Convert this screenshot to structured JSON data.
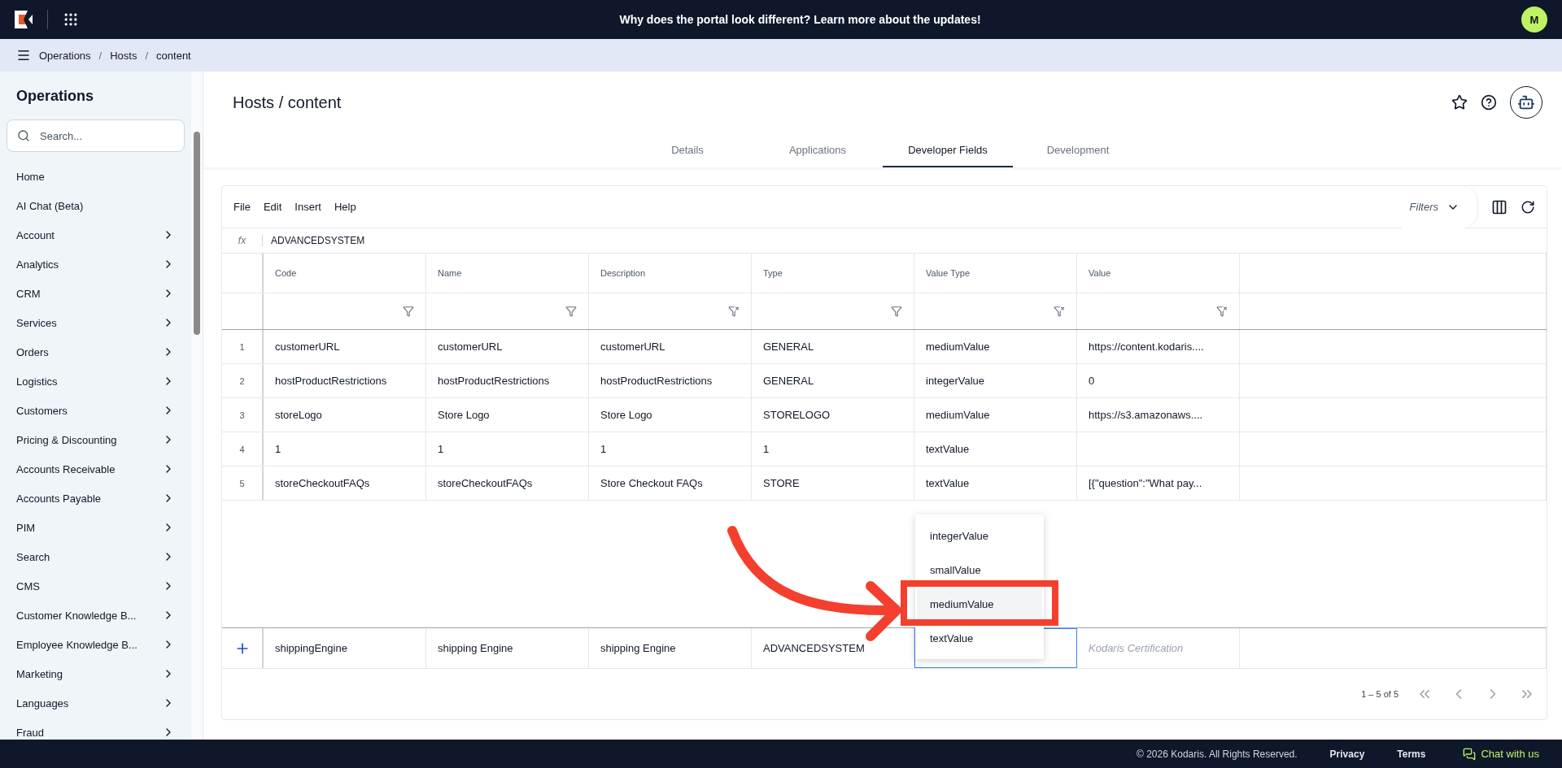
{
  "top_bar": {
    "banner": "Why does the portal look different? ",
    "banner_link": "Learn more about the updates!",
    "avatar": "M"
  },
  "breadcrumb": [
    "Operations",
    "Hosts",
    "content"
  ],
  "breadcrumb_separator": "/",
  "sidebar": {
    "title": "Operations",
    "search": {
      "placeholder": "Search..."
    },
    "items": [
      {
        "label": "Home",
        "has_children": false
      },
      {
        "label": "AI Chat (Beta)",
        "has_children": false
      },
      {
        "label": "Account",
        "has_children": true
      },
      {
        "label": "Analytics",
        "has_children": true
      },
      {
        "label": "CRM",
        "has_children": true
      },
      {
        "label": "Services",
        "has_children": true
      },
      {
        "label": "Orders",
        "has_children": true
      },
      {
        "label": "Logistics",
        "has_children": true
      },
      {
        "label": "Customers",
        "has_children": true
      },
      {
        "label": "Pricing & Discounting",
        "has_children": true
      },
      {
        "label": "Accounts Receivable",
        "has_children": true
      },
      {
        "label": "Accounts Payable",
        "has_children": true
      },
      {
        "label": "PIM",
        "has_children": true
      },
      {
        "label": "Search",
        "has_children": true
      },
      {
        "label": "CMS",
        "has_children": true
      },
      {
        "label": "Customer Knowledge B...",
        "has_children": true
      },
      {
        "label": "Employee Knowledge B...",
        "has_children": true
      },
      {
        "label": "Marketing",
        "has_children": true
      },
      {
        "label": "Languages",
        "has_children": true
      },
      {
        "label": "Fraud",
        "has_children": true
      }
    ]
  },
  "page_title": "Hosts / content",
  "tabs": [
    {
      "label": "Details",
      "selected": false
    },
    {
      "label": "Applications",
      "selected": false
    },
    {
      "label": "Developer Fields",
      "selected": true
    },
    {
      "label": "Development",
      "selected": false
    }
  ],
  "grid": {
    "menu": [
      "File",
      "Edit",
      "Insert",
      "Help"
    ],
    "filters_label": "Filters",
    "formula_label": "fx",
    "formula": "ADVANCEDSYSTEM",
    "columns": [
      {
        "label": "Code",
        "filter_cleared": false
      },
      {
        "label": "Name",
        "filter_cleared": false
      },
      {
        "label": "Description",
        "filter_cleared": true
      },
      {
        "label": "Type",
        "filter_cleared": false
      },
      {
        "label": "Value Type",
        "filter_cleared": true
      },
      {
        "label": "Value",
        "filter_cleared": true
      }
    ],
    "rows": [
      {
        "number": "1",
        "cells": [
          "customerURL",
          "customerURL",
          "customerURL",
          "GENERAL",
          "mediumValue",
          "https://content.kodaris...."
        ]
      },
      {
        "number": "2",
        "cells": [
          "hostProductRestrictions",
          "hostProductRestrictions",
          "hostProductRestrictions",
          "GENERAL",
          "integerValue",
          "0"
        ]
      },
      {
        "number": "3",
        "cells": [
          "storeLogo",
          "Store Logo",
          "Store Logo",
          "STORELOGO",
          "mediumValue",
          "https://s3.amazonaws...."
        ]
      },
      {
        "number": "4",
        "cells": [
          "1",
          "1",
          "1",
          "1",
          "textValue",
          ""
        ]
      },
      {
        "number": "5",
        "cells": [
          "storeCheckoutFAQs",
          "storeCheckoutFAQs",
          "Store Checkout FAQs",
          "STORE",
          "textValue",
          "[{\"question\":\"What pay..."
        ]
      }
    ],
    "new_row": {
      "cells": [
        "shippingEngine",
        "shipping Engine",
        "shipping Engine",
        "ADVANCEDSYSTEM"
      ],
      "value_placeholder": "Kodaris Certification",
      "dropdown": [
        {
          "label": "integerValue",
          "selected": false
        },
        {
          "label": "smallValue",
          "selected": false
        },
        {
          "label": "mediumValue",
          "selected": true
        },
        {
          "label": "textValue",
          "selected": false
        }
      ]
    },
    "pagination": "1 – 5 of 5"
  },
  "footer": {
    "copyright": "© 2026 Kodaris. All Rights Reserved.",
    "links": [
      "Privacy",
      "Terms"
    ],
    "chat": "Chat with us"
  }
}
